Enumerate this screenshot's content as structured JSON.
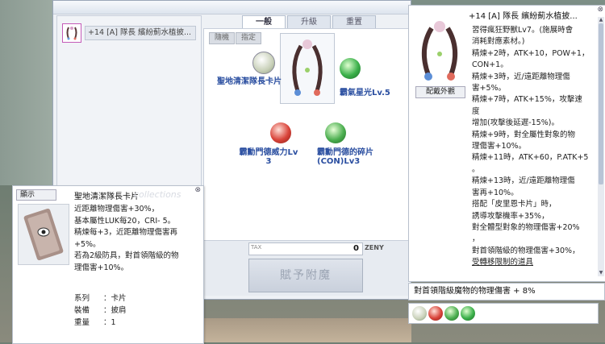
{
  "item": {
    "slot_name": "+14 [A] 隊長 繽紛薊水植披...",
    "tooltip_title": "+14 [A] 隊長 繽紛薊水植披...",
    "look_button": "配戴外觀",
    "desc_lines": [
      "習得瘋狂野獸Lv7。(施展時會",
      "消耗對應素材。)",
      "精煉+2時，ATK+10，POW+1，",
      "CON+1。",
      "精煉+3時，近/遠距離物理傷",
      "害+5%。",
      "精煉+7時，ATK+15%，攻擊速度",
      "增加(攻擊後延遲-15%)。",
      "精煉+9時，對全屬性對象的物",
      "理傷害+10%。",
      "精煉+11時，ATK+60，P.ATK+5",
      "。",
      "精煉+13時，近/遠距離物理傷",
      "害再+10%。",
      "搭配「皮里恩卡片」時，",
      "誘導攻擊機率+35%，",
      "對全體型對象的物理傷害+20%",
      "，",
      "對首領階級的物理傷害+30%，"
    ],
    "restricted_link": "受轉移限制的道具"
  },
  "tabs": [
    "一般",
    "升級",
    "重置"
  ],
  "modes": [
    "隨機",
    "指定"
  ],
  "options": [
    {
      "label": "聖地清潔隊長卡片",
      "color": "#6f8a6a"
    },
    {
      "label": "霸氣星光Lv.5",
      "color": "#3bb04a"
    },
    {
      "label": "霸勳門德威力Lv\n3",
      "color": "#d9443a"
    },
    {
      "label": "霸勳門德的碎片\n(CON)Lv3",
      "color": "#4caf50"
    }
  ],
  "tax": {
    "label": "TAX",
    "value": "0",
    "unit": "ZENY"
  },
  "apply_button": "賦予附魔",
  "card_tooltip": {
    "title": "聖地清潔隊長卡片",
    "watermark": "collections",
    "show_button": "顯示",
    "desc_lines": [
      "近距離物理傷害+30%，",
      "基本屬性LUK每20，CRI- 5。",
      "精煉每+3，近距離物理傷害再",
      "+5%。",
      "若為2級防具，對首領階級的物",
      "理傷害+10%。"
    ],
    "meta": [
      {
        "k": "系列",
        "v": "卡片"
      },
      {
        "k": "裝備",
        "v": "披肩"
      },
      {
        "k": "重量",
        "v": "1"
      }
    ]
  },
  "selected_option": "對首領階級魔物的物理傷害 + 8%",
  "gems": [
    "#6f8a6a",
    "#d9443a",
    "#4caf50",
    "#3bb04a"
  ],
  "close_glyph": "⊗"
}
